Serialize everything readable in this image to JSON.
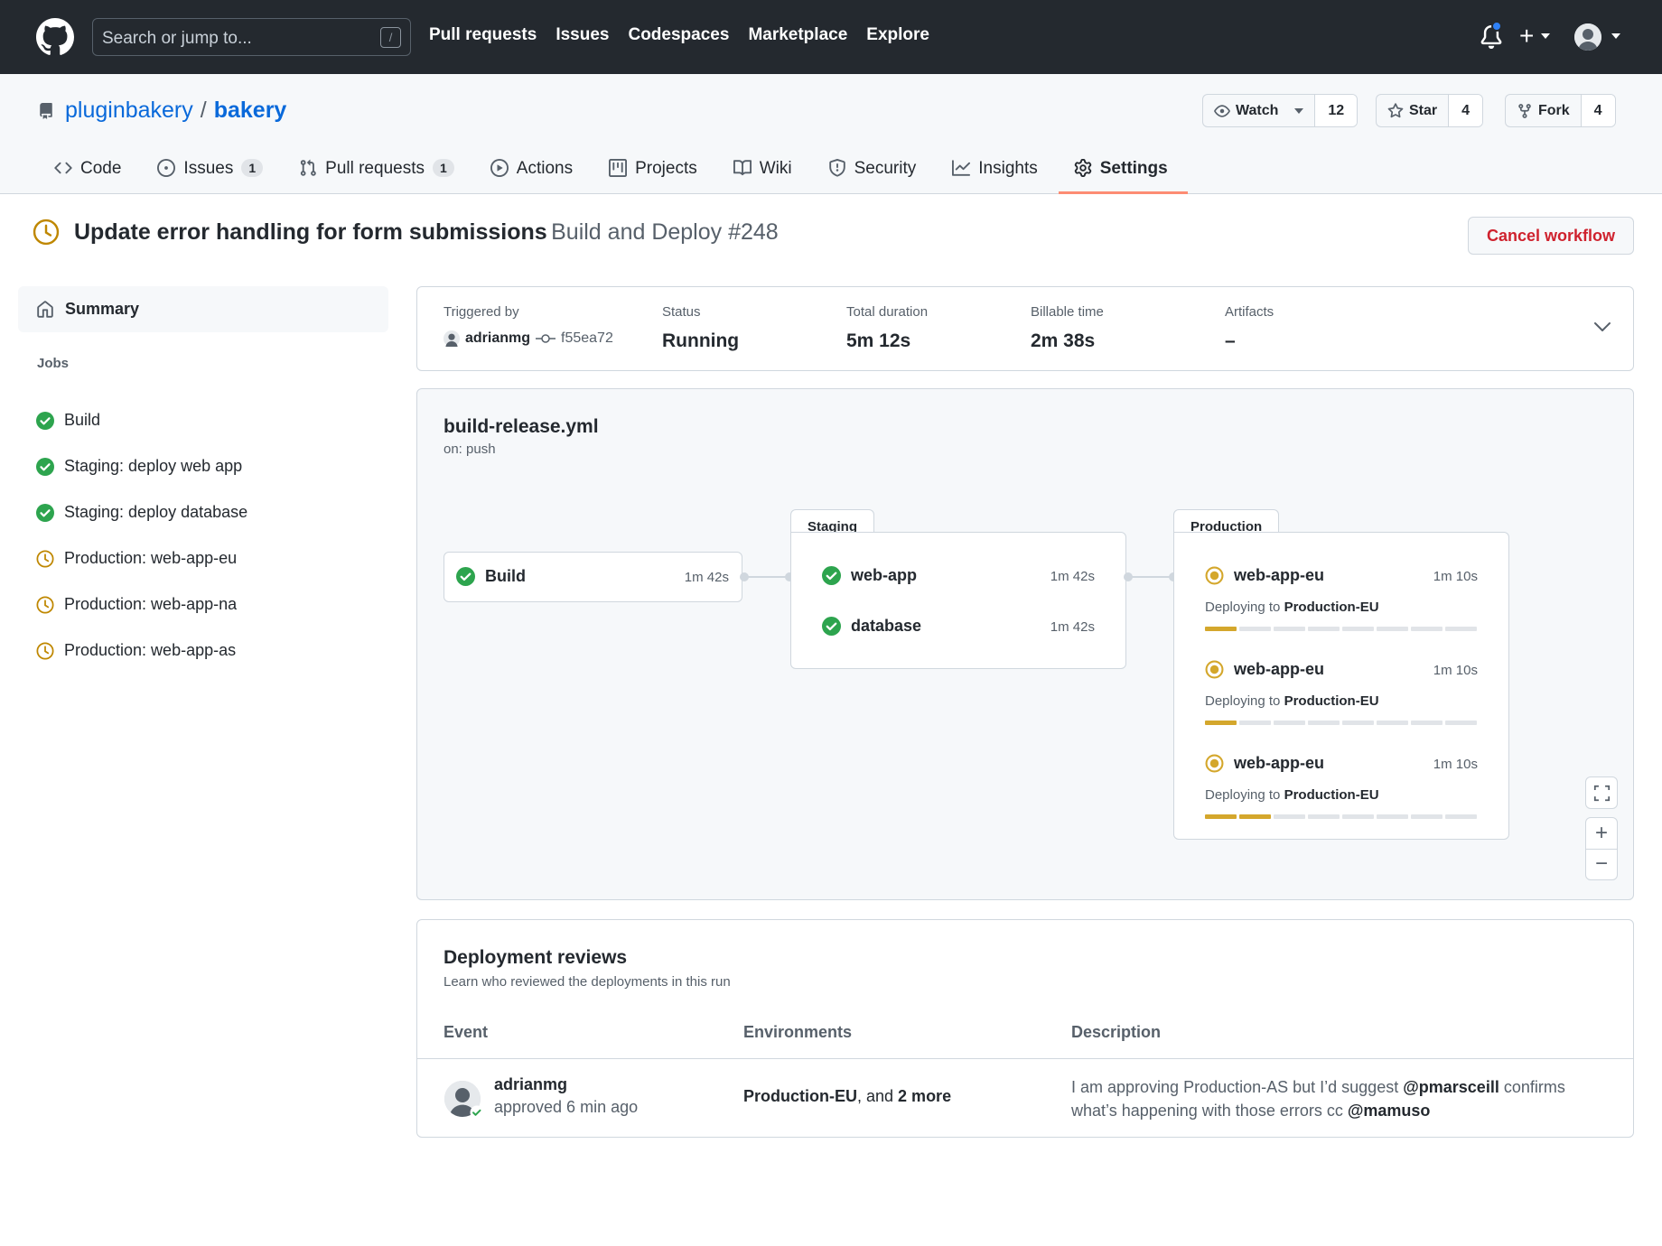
{
  "header": {
    "search_placeholder": "Search or jump to...",
    "search_shortcut": "/",
    "nav": [
      "Pull requests",
      "Issues",
      "Codespaces",
      "Marketplace",
      "Explore"
    ],
    "plus": "+"
  },
  "repo": {
    "owner": "pluginbakery",
    "separator": "/",
    "name": "bakery",
    "watch": {
      "label": "Watch",
      "count": "12"
    },
    "star": {
      "label": "Star",
      "count": "4"
    },
    "fork": {
      "label": "Fork",
      "count": "4"
    },
    "tabs": [
      {
        "label": "Code",
        "icon": "code-icon"
      },
      {
        "label": "Issues",
        "count": "1",
        "icon": "issue-icon"
      },
      {
        "label": "Pull requests",
        "count": "1",
        "icon": "pull-request-icon"
      },
      {
        "label": "Actions",
        "icon": "play-icon"
      },
      {
        "label": "Projects",
        "icon": "project-icon"
      },
      {
        "label": "Wiki",
        "icon": "book-icon"
      },
      {
        "label": "Security",
        "icon": "shield-icon"
      },
      {
        "label": "Insights",
        "icon": "graph-icon"
      },
      {
        "label": "Settings",
        "icon": "gear-icon",
        "active": true
      }
    ]
  },
  "run": {
    "title": "Update error handling for form submissions",
    "subtitle": "Build and Deploy #248",
    "cancel_label": "Cancel workflow"
  },
  "sidebar": {
    "summary_label": "Summary",
    "jobs_label": "Jobs",
    "jobs": [
      {
        "label": "Build",
        "status": "success"
      },
      {
        "label": "Staging: deploy web app",
        "status": "success"
      },
      {
        "label": "Staging: deploy database",
        "status": "success"
      },
      {
        "label": "Production: web-app-eu",
        "status": "pending"
      },
      {
        "label": "Production: web-app-na",
        "status": "pending"
      },
      {
        "label": "Production: web-app-as",
        "status": "pending"
      }
    ]
  },
  "summary": {
    "triggered_by_label": "Triggered by",
    "user": "adrianmg",
    "sha": "f55ea72",
    "status_label": "Status",
    "status_value": "Running",
    "duration_label": "Total duration",
    "duration_value": "5m 12s",
    "billable_label": "Billable time",
    "billable_value": "2m 38s",
    "artifacts_label": "Artifacts",
    "artifacts_value": "–"
  },
  "graph": {
    "file": "build-release.yml",
    "trigger": "on: push",
    "build": {
      "name": "Build",
      "duration": "1m 42s"
    },
    "staging": {
      "label": "Staging",
      "jobs": [
        {
          "name": "web-app",
          "duration": "1m 42s"
        },
        {
          "name": "database",
          "duration": "1m 42s"
        }
      ]
    },
    "production": {
      "label": "Production",
      "deploying_prefix": "Deploying to",
      "jobs": [
        {
          "name": "web-app-eu",
          "duration": "1m 10s",
          "env": "Production-EU",
          "progress_segments": 8,
          "progress_done": 1
        },
        {
          "name": "web-app-eu",
          "duration": "1m 10s",
          "env": "Production-EU",
          "progress_segments": 8,
          "progress_done": 1
        },
        {
          "name": "web-app-eu",
          "duration": "1m 10s",
          "env": "Production-EU",
          "progress_segments": 8,
          "progress_done": 2
        }
      ]
    },
    "zoom_in": "+",
    "zoom_out": "−"
  },
  "reviews": {
    "title": "Deployment reviews",
    "subtitle": "Learn who reviewed the deployments in this run",
    "columns": [
      "Event",
      "Environments",
      "Description"
    ],
    "rows": [
      {
        "user": "adrianmg",
        "when": "approved 6 min ago",
        "env_primary": "Production-EU",
        "env_joiner": ", and ",
        "env_more": "2 more",
        "desc_1": "I am approving Production-AS but I’d suggest ",
        "mention_1": "@pmarsceill",
        "desc_2": " confirms what’s happening with those errors cc ",
        "mention_2": "@mamuso"
      }
    ]
  },
  "colors": {
    "success": "#2da44e",
    "pending": "#bf8700",
    "accent": "#0969da",
    "danger": "#cf222e"
  }
}
